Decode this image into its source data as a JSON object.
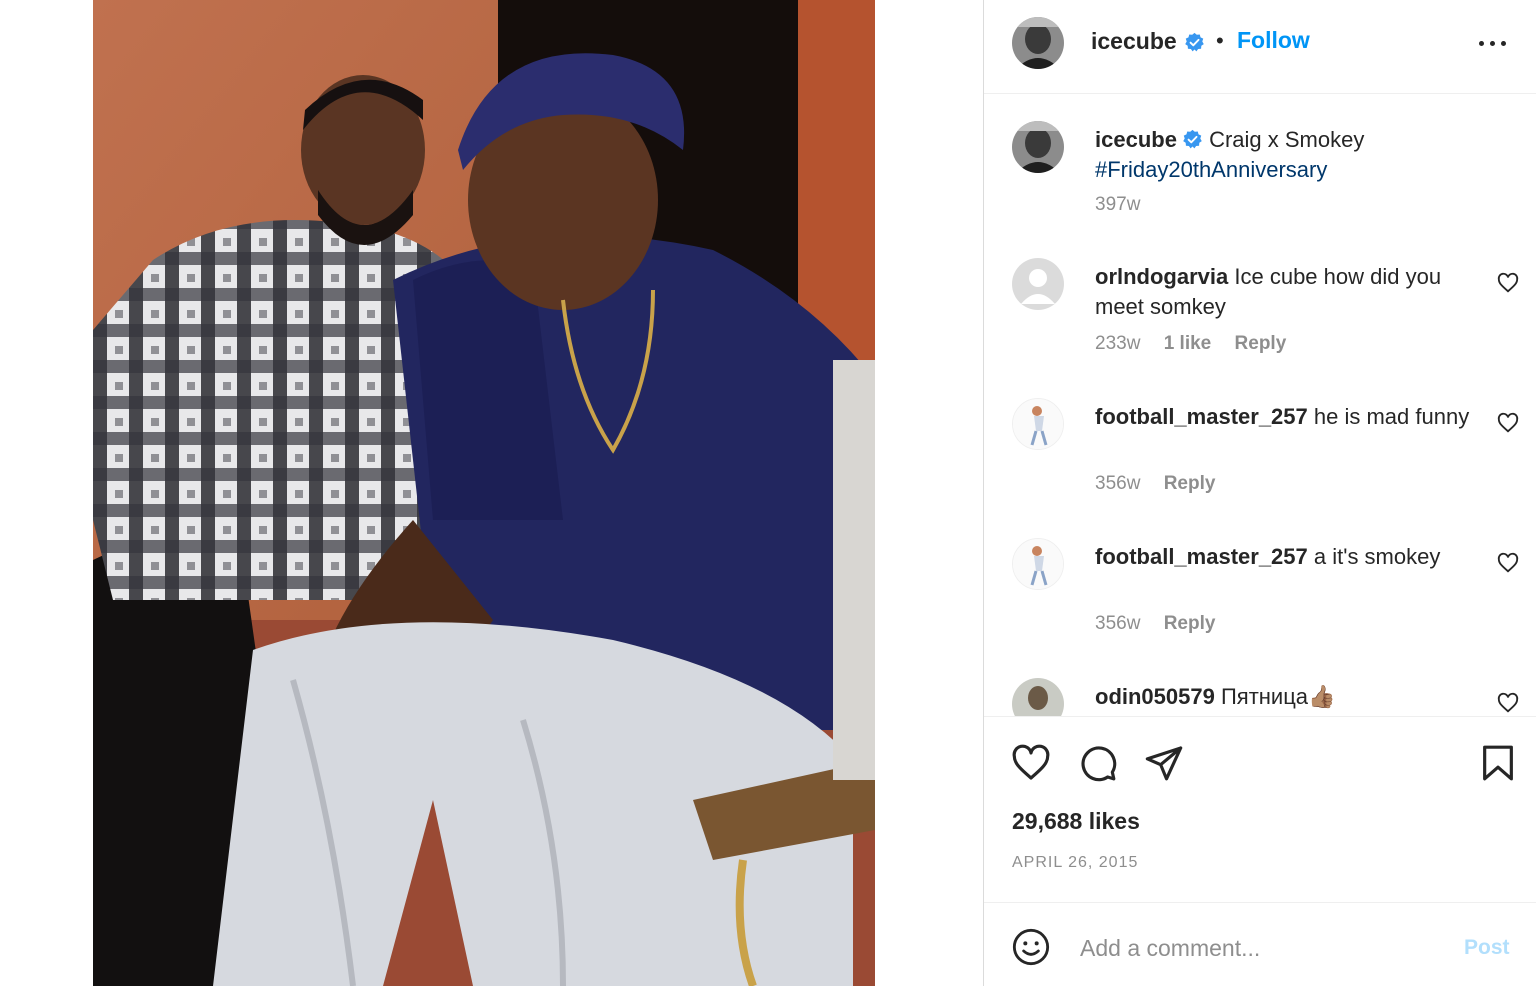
{
  "post": {
    "image_alt": "Craig x Smokey photo",
    "author": {
      "username": "icecube",
      "verified": true,
      "follow_label": "Follow",
      "separator": "•"
    },
    "caption": {
      "username": "icecube",
      "text": "Craig x Smokey",
      "hashtag": "#Friday20thAnniversary",
      "time": "397w"
    },
    "comments": [
      {
        "username": "orlndogarvia",
        "text": "Ice cube how did you meet somkey",
        "time": "233w",
        "likes": "1 like",
        "reply": "Reply"
      },
      {
        "username": "football_master_257",
        "text": "he is mad funny",
        "time": "356w",
        "reply": "Reply"
      },
      {
        "username": "football_master_257",
        "text": "a it's smokey",
        "time": "356w",
        "reply": "Reply"
      },
      {
        "username": "odin050579",
        "text": "Пятница👍🏽"
      }
    ],
    "likes": "29,688 likes",
    "date": "APRIL 26, 2015",
    "composer": {
      "placeholder": "Add a comment...",
      "post_label": "Post"
    }
  },
  "icons": {
    "header": [
      "verified-badge-icon",
      "more-options-icon"
    ],
    "actions": [
      "heart-icon",
      "comment-icon",
      "share-icon",
      "bookmark-icon"
    ],
    "composer": [
      "emoji-icon"
    ]
  },
  "colors": {
    "accent": "#0095f6",
    "text": "#262626",
    "muted": "#8e8e8e",
    "hashtag": "#00376b",
    "post_disabled": "#b2dffc"
  }
}
